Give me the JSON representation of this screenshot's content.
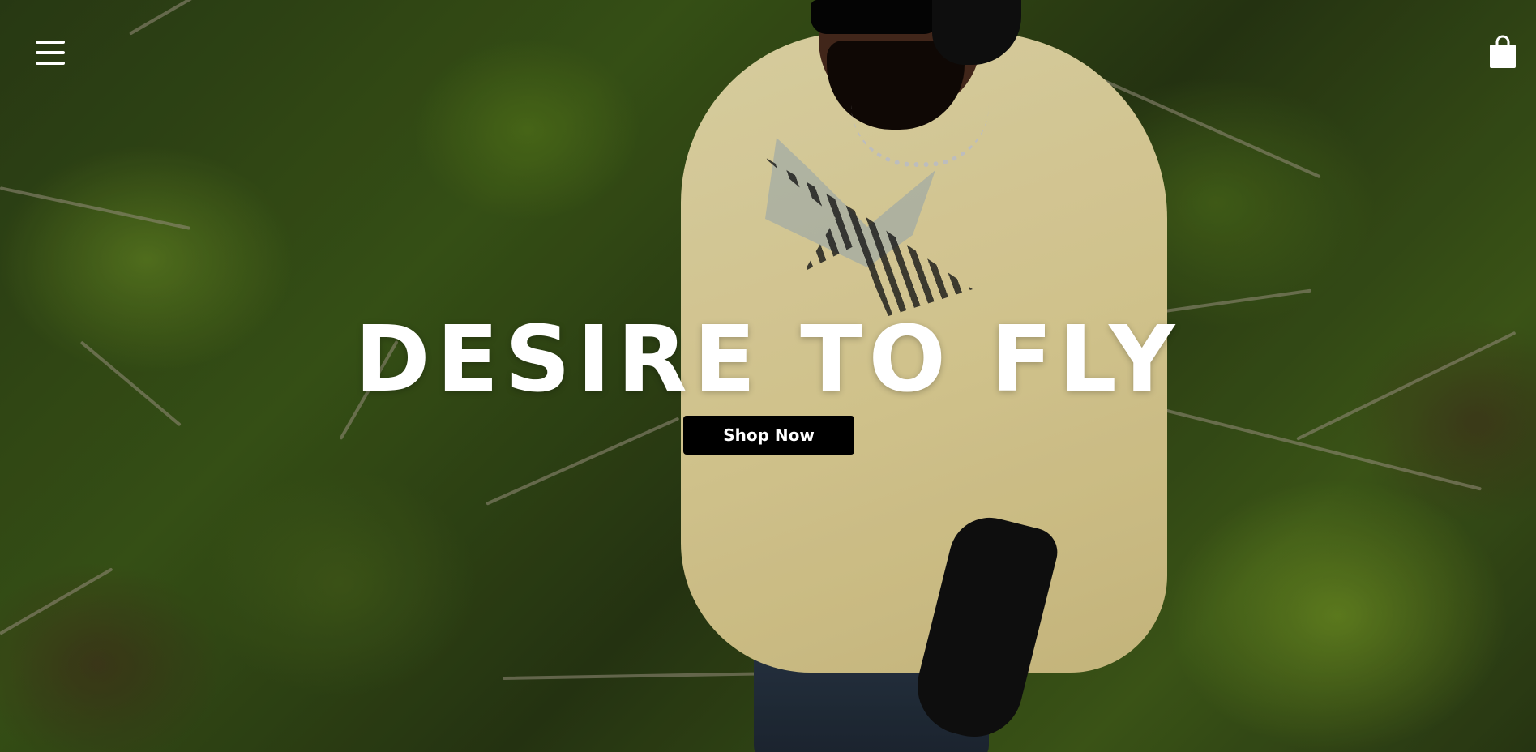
{
  "header": {
    "menu_icon": "hamburger-menu-icon",
    "cart_icon": "shopping-bag-icon"
  },
  "hero": {
    "title": "DESIRE TO FLY",
    "cta_label": "Shop Now",
    "image_description_icon": "hero-photo"
  },
  "colors": {
    "title": "#ffffff",
    "button_bg": "#000000",
    "button_text": "#ffffff"
  }
}
